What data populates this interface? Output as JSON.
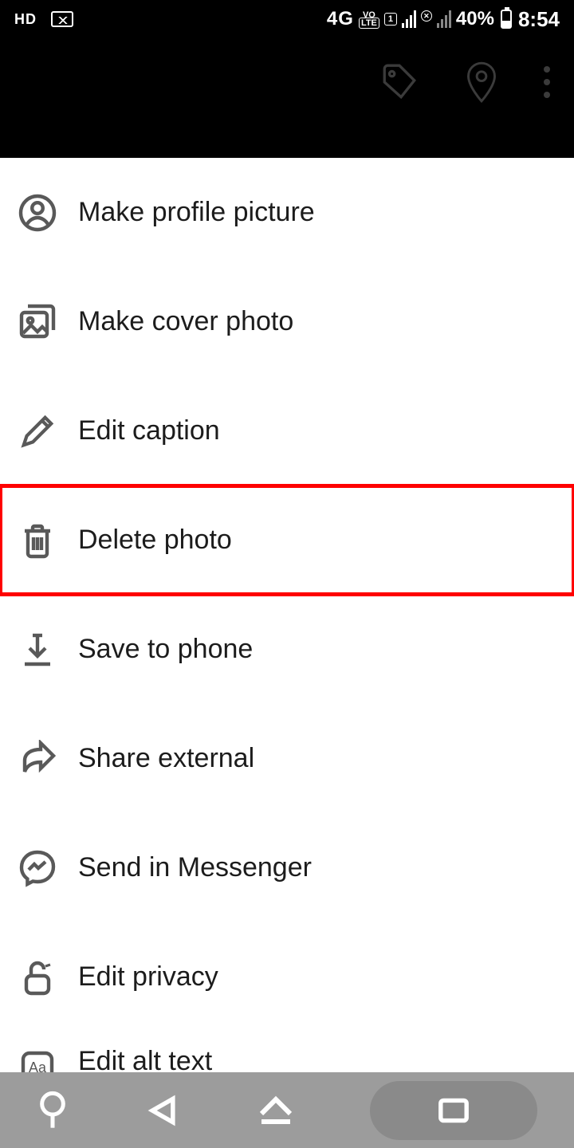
{
  "status": {
    "hd": "HD",
    "network": "4G",
    "vo": "VO",
    "lte": "LTE",
    "sim": "1",
    "battery_pct": "40%",
    "time": "8:54"
  },
  "menu": {
    "items": [
      {
        "label": "Make profile picture"
      },
      {
        "label": "Make cover photo"
      },
      {
        "label": "Edit caption"
      },
      {
        "label": "Delete photo"
      },
      {
        "label": "Save to phone"
      },
      {
        "label": "Share external"
      },
      {
        "label": "Send in Messenger"
      },
      {
        "label": "Edit privacy"
      },
      {
        "label": "Edit alt text"
      }
    ]
  }
}
